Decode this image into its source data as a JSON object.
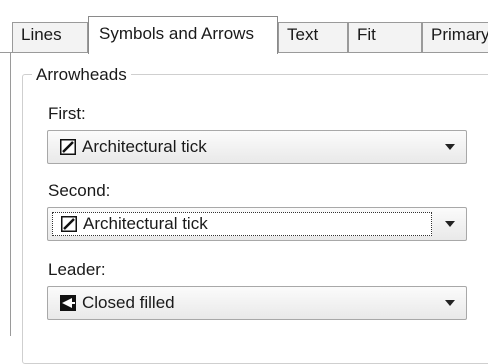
{
  "tabs": [
    {
      "label": "Lines",
      "active": false
    },
    {
      "label": "Symbols and Arrows",
      "active": true
    },
    {
      "label": "Text",
      "active": false
    },
    {
      "label": "Fit",
      "active": false
    },
    {
      "label": "Primary Units",
      "active": false
    }
  ],
  "arrowheads": {
    "group_title": "Arrowheads",
    "first": {
      "label": "First:",
      "value": "Architectural tick",
      "icon": "architectural-tick-icon"
    },
    "second": {
      "label": "Second:",
      "value": "Architectural tick",
      "icon": "architectural-tick-icon",
      "focused": true
    },
    "leader": {
      "label": "Leader:",
      "value": "Closed filled",
      "icon": "closed-filled-arrow-icon"
    }
  }
}
